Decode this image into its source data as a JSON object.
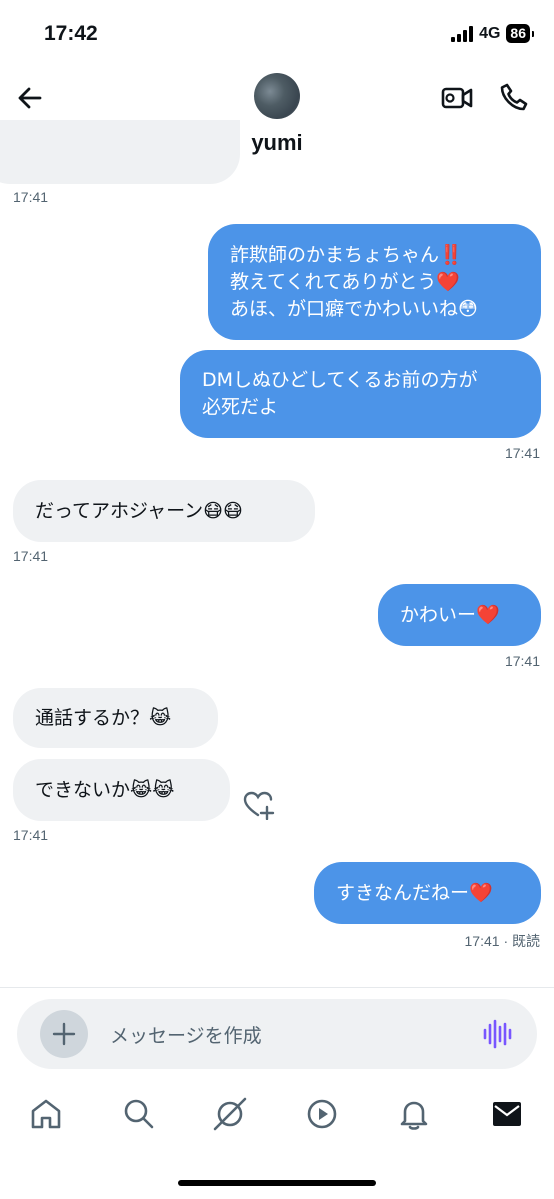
{
  "status": {
    "time": "17:42",
    "network": "4G",
    "battery": "86"
  },
  "header": {
    "username": "yumi"
  },
  "messages": [
    {
      "timestamp": "17:41"
    },
    {
      "lines": [
        "詐欺師のかまちょちゃん‼️",
        "教えてくれてありがとう❤️",
        "あほ、が口癖でかわいいね😳"
      ]
    },
    {
      "lines": [
        "DMしぬひどしてくるお前の方が",
        "必死だよ"
      ],
      "timestamp": "17:41"
    },
    {
      "text": "だってアホジャーン😷😷",
      "timestamp": "17:41"
    },
    {
      "text": "かわいー❤️",
      "timestamp": "17:41"
    },
    {
      "text": "通話するか？😹"
    },
    {
      "text": "できないか😹😹",
      "timestamp": "17:41"
    },
    {
      "text": "すきなんだねー❤️",
      "timestamp": "17:41 · 既読"
    }
  ],
  "composer": {
    "placeholder": "メッセージを作成"
  },
  "icons": {
    "back": "back-arrow-icon",
    "video": "video-camera-icon",
    "call": "phone-icon",
    "react": "heart-plus-icon",
    "add": "plus-icon",
    "voice": "voice-wave-icon",
    "nav": [
      "home-icon",
      "search-icon",
      "grok-icon",
      "play-icon",
      "bell-icon",
      "mail-icon"
    ]
  },
  "colors": {
    "outgoing": "#4c94e8",
    "incoming": "#eff1f3",
    "voice": "#7856ff"
  }
}
